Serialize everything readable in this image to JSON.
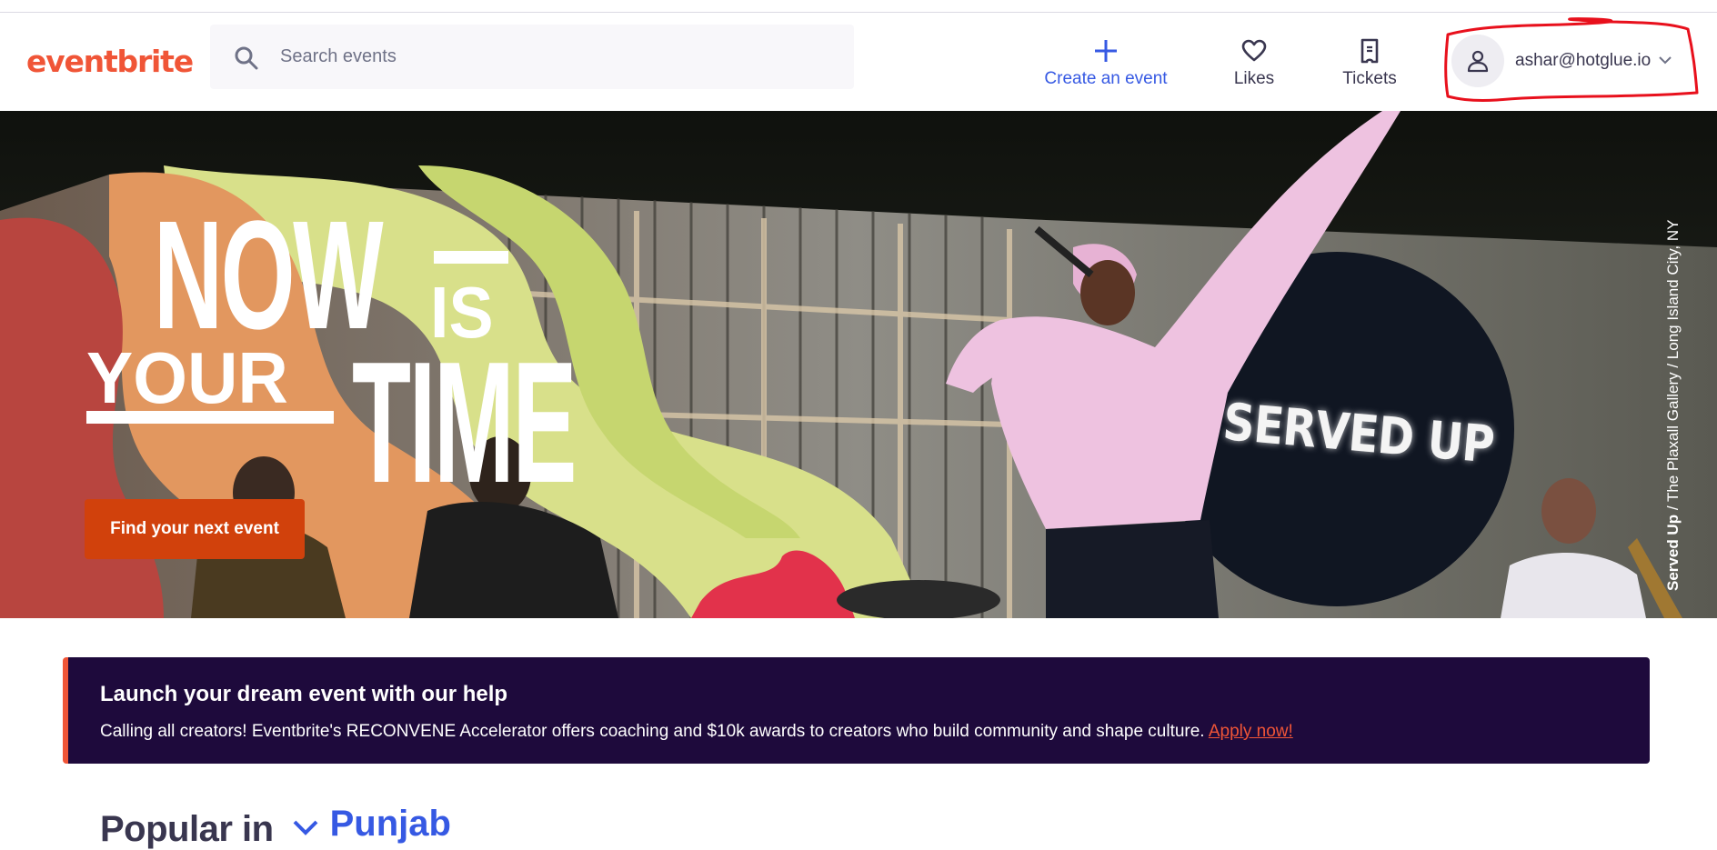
{
  "header": {
    "logo": "eventbrite",
    "search": {
      "placeholder": "Search events",
      "icon": "search-icon"
    },
    "nav": [
      {
        "label": "Create an event",
        "icon": "plus-icon"
      },
      {
        "label": "Likes",
        "icon": "heart-icon"
      },
      {
        "label": "Tickets",
        "icon": "ticket-icon"
      }
    ],
    "account": {
      "email": "ashar@hotglue.io",
      "icon": "user-icon"
    }
  },
  "hero": {
    "title_now": "NOW",
    "title_is": "IS",
    "title_your": "YOUR",
    "title_time": "TIME",
    "sign_text": "SERVED UP",
    "cta_label": "Find your next event",
    "credit_bold": "Served Up",
    "credit_rest": " / The Plaxall Gallery / Long Island City, NY"
  },
  "banner": {
    "title": "Launch your dream event with our help",
    "body": "Calling all creators! Eventbrite's RECONVENE Accelerator offers coaching and $10k awards to creators who build community and shape culture. ",
    "link": "Apply now!"
  },
  "popular": {
    "label": "Popular in",
    "location": "Punjab"
  },
  "colors": {
    "brand": "#f05537",
    "accent_blue": "#3659e3",
    "cta": "#d1410c",
    "banner_bg": "#1e0a3c",
    "annotation": "#e8101c"
  }
}
